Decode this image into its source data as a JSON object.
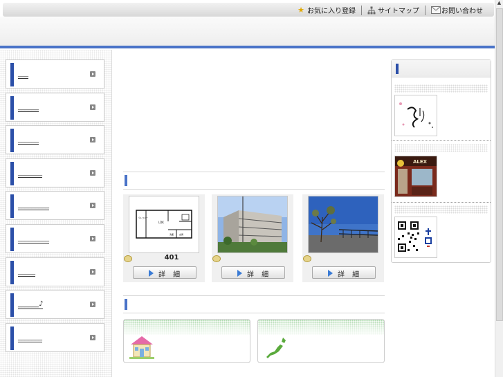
{
  "top_links": [
    {
      "label": "お気に入り登録",
      "icon": "star-icon"
    },
    {
      "label": "サイトマップ",
      "icon": "sitemap-icon"
    },
    {
      "label": "お問い合わせ",
      "icon": "mail-icon"
    }
  ],
  "sidebar": {
    "items": [
      {
        "label": "___"
      },
      {
        "label": "______"
      },
      {
        "label": "______"
      },
      {
        "label": "_______"
      },
      {
        "label": "_________"
      },
      {
        "label": "_________"
      },
      {
        "label": "_____"
      },
      {
        "label": "______♪"
      },
      {
        "label": "_______"
      }
    ]
  },
  "listings": [
    {
      "caption": "401",
      "button": "詳 細",
      "image": "floor-plan"
    },
    {
      "caption": "",
      "button": "詳 細",
      "image": "apartment-building-photo"
    },
    {
      "caption": "",
      "button": "詳 細",
      "image": "rooftop-view-photo"
    }
  ],
  "banners": [
    {
      "icon": "house-icon"
    },
    {
      "icon": "japan-map-icon"
    }
  ],
  "right_panel": {
    "thumbs": [
      "calligraphy-art",
      "shop-storefront-photo",
      "qr-code"
    ]
  },
  "colors": {
    "accent": "#4a73c8",
    "nav_bar": "#2b4fa8"
  }
}
